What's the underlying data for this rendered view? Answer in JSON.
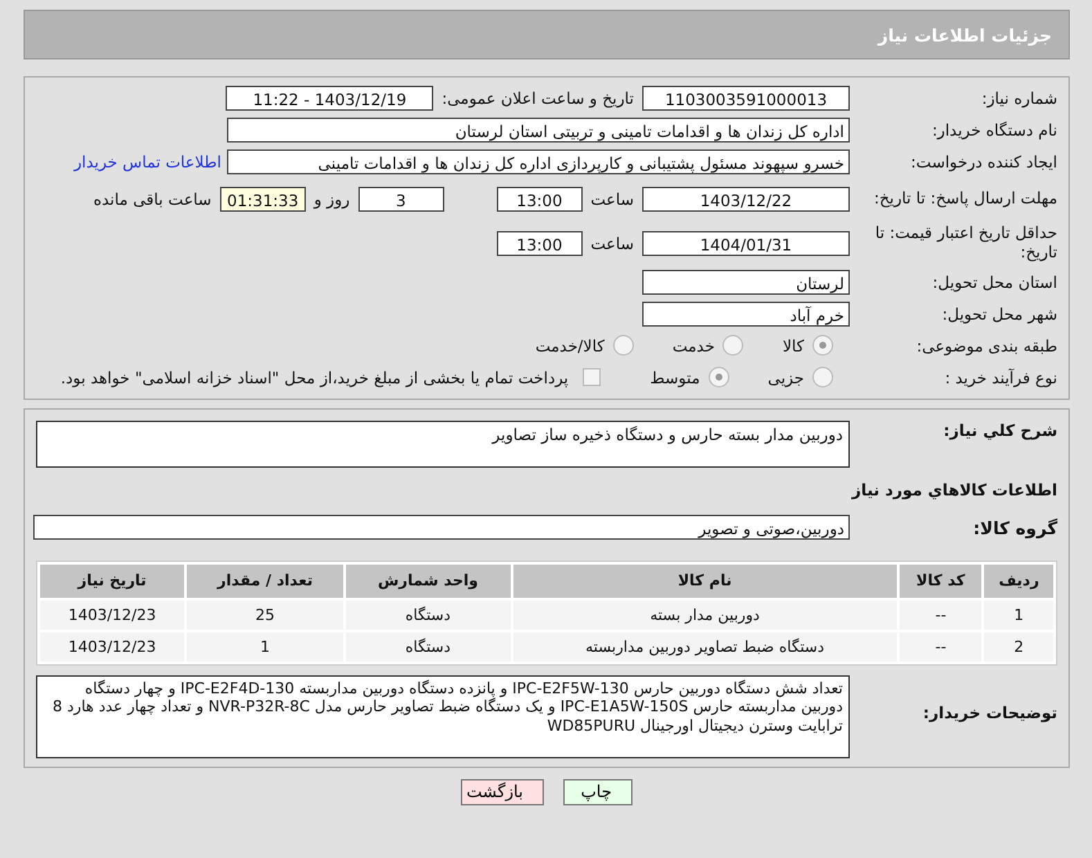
{
  "header": {
    "title": "جزئیات اطلاعات نیاز"
  },
  "need_number": {
    "label": "شماره نیاز:",
    "value": "1103003591000013"
  },
  "announce": {
    "label": "تاریخ و ساعت اعلان عمومی:",
    "value": "1403/12/19 - 11:22"
  },
  "buyer": {
    "label": "نام دستگاه خریدار:",
    "value": "اداره کل زندان ها و اقدامات تامینی و تربیتی استان لرستان"
  },
  "creator": {
    "label": "ایجاد کننده درخواست:",
    "value": "خسرو سپهوند مسئول پشتیبانی و کارپردازی اداره کل زندان ها و اقدامات تامینی",
    "link": "اطلاعات تماس خریدار"
  },
  "deadline": {
    "label": "مهلت ارسال پاسخ: تا تاریخ:",
    "date": "1403/12/22",
    "time_label": "ساعت",
    "time": "13:00",
    "days": "3",
    "days_label": "روز و",
    "remaining": "01:31:33",
    "remaining_label": "ساعت باقی مانده"
  },
  "validity": {
    "label": "حداقل تاریخ اعتبار قیمت: تا تاریخ:",
    "date": "1404/01/31",
    "time_label": "ساعت",
    "time": "13:00"
  },
  "province": {
    "label": "استان محل تحویل:",
    "value": "لرستان"
  },
  "city": {
    "label": "شهر محل تحویل:",
    "value": "خرم آباد"
  },
  "category": {
    "label": "طبقه بندی موضوعی:",
    "options": [
      {
        "label": "کالا",
        "selected": true
      },
      {
        "label": "خدمت",
        "selected": false
      },
      {
        "label": "کالا/خدمت",
        "selected": false
      }
    ]
  },
  "process": {
    "label": "نوع فرآیند خرید :",
    "options": [
      {
        "label": "جزیی",
        "selected": false
      },
      {
        "label": "متوسط",
        "selected": true
      }
    ],
    "treasury": {
      "checked": false,
      "text": "پرداخت تمام یا بخشی از مبلغ خرید،از محل \"اسناد خزانه اسلامی\" خواهد بود."
    }
  },
  "summary": {
    "label": "شرح کلي نیاز:",
    "value": "دوربین مدار بسته حارس و دستگاه ذخیره ساز تصاویر"
  },
  "goods_heading": "اطلاعات کالاهاي مورد نیاز",
  "goods_group": {
    "label": "گروه کالا:",
    "value": "دوربین،صوتی و تصویر"
  },
  "table": {
    "columns": [
      "ردیف",
      "کد کالا",
      "نام کالا",
      "واحد شمارش",
      "تعداد / مقدار",
      "تاریخ نیاز"
    ],
    "rows": [
      [
        "1",
        "--",
        "دوربین مدار بسته",
        "دستگاه",
        "25",
        "1403/12/23"
      ],
      [
        "2",
        "--",
        "دستگاه ضبط تصاویر دوربین مداربسته",
        "دستگاه",
        "1",
        "1403/12/23"
      ]
    ]
  },
  "buyer_notes": {
    "label": "توضیحات خریدار:",
    "value": "تعداد شش دستگاه دوربین حارس IPC-E2F5W-130 و پانزده دستگاه دوربین مداربسته IPC-E2F4D-130 و چهار دستگاه دوربین مداربسته حارس IPC-E1A5W-150S و یک دستگاه ضبط تصاویر حارس مدل NVR-P32R-8C و تعداد چهار عدد هارد 8 ترابایت وسترن دیجیتال اورجینال  WD85PURU"
  },
  "buttons": [
    {
      "label": "چاپ",
      "kind": "print"
    },
    {
      "label": "بازگشت",
      "kind": "back"
    }
  ]
}
